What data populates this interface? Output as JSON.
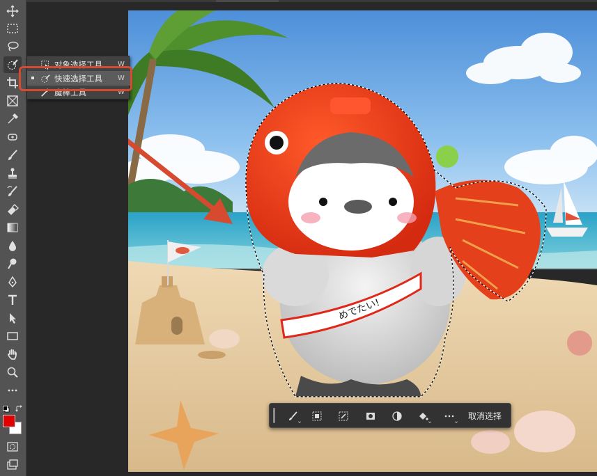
{
  "toolbar": {
    "tools": [
      "move-tool",
      "marquee-tool",
      "lasso-tool",
      "quick-selection-tool",
      "crop-tool",
      "frame-tool",
      "eyedropper-tool",
      "spot-healing-tool",
      "brush-tool",
      "clone-stamp-tool",
      "history-brush-tool",
      "eraser-tool",
      "gradient-tool",
      "blur-tool",
      "dodge-tool",
      "pen-tool",
      "type-tool",
      "path-selection-tool",
      "rectangle-tool",
      "hand-tool",
      "zoom-tool",
      "more-tools"
    ],
    "foreground_color": "#e00000",
    "background_color": "#ffffff"
  },
  "flyout": {
    "items": [
      {
        "label": "对象选择工具",
        "shortcut": "W",
        "icon": "object-selection-icon",
        "selected": false
      },
      {
        "label": "快速选择工具",
        "shortcut": "W",
        "icon": "quick-selection-icon",
        "selected": true
      },
      {
        "label": "魔棒工具",
        "shortcut": "W",
        "icon": "magic-wand-icon",
        "selected": false
      }
    ]
  },
  "annotation": {
    "color": "#d64a2f"
  },
  "canvas": {
    "sash_text": "めでたい!"
  },
  "context_bar": {
    "buttons": [
      "brush-options-icon",
      "select-subject-icon",
      "refine-edges-icon",
      "mask-icon",
      "invert-icon",
      "fill-icon",
      "more-icon"
    ],
    "deselect_label": "取消选择"
  }
}
